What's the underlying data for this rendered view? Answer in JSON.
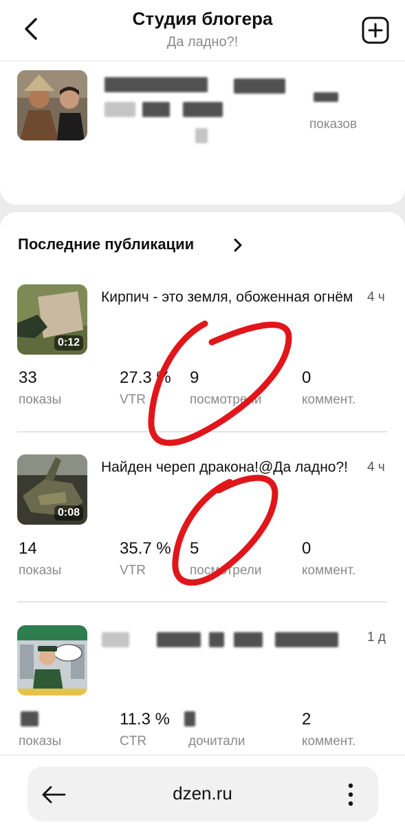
{
  "header": {
    "title": "Студия блогера",
    "subtitle": "Да ладно?!"
  },
  "profile": {
    "views_label": "показов"
  },
  "publications": {
    "section_title": "Последние публикации",
    "items": [
      {
        "title": "Кирпич - это земля, обоженная огнём",
        "time": "4 ч",
        "duration": "0:12",
        "stats": [
          {
            "value": "33",
            "label": "показы"
          },
          {
            "value": "27.3 %",
            "label": "VTR"
          },
          {
            "value": "9",
            "label": "посмотрели"
          },
          {
            "value": "0",
            "label": "коммент."
          }
        ]
      },
      {
        "title": "Найден череп дракона!@Да ладно?!",
        "time": "4 ч",
        "duration": "0:08",
        "stats": [
          {
            "value": "14",
            "label": "показы"
          },
          {
            "value": "35.7 %",
            "label": "VTR"
          },
          {
            "value": "5",
            "label": "посмотрели"
          },
          {
            "value": "0",
            "label": "коммент."
          }
        ]
      },
      {
        "title": "",
        "time": "1 д",
        "stats": [
          {
            "value": "",
            "label": "показы"
          },
          {
            "value": "11.3 %",
            "label": "CTR"
          },
          {
            "value": "",
            "label": "дочитали"
          },
          {
            "value": "2",
            "label": "коммент."
          }
        ]
      }
    ]
  },
  "browser": {
    "url": "dzen.ru"
  }
}
